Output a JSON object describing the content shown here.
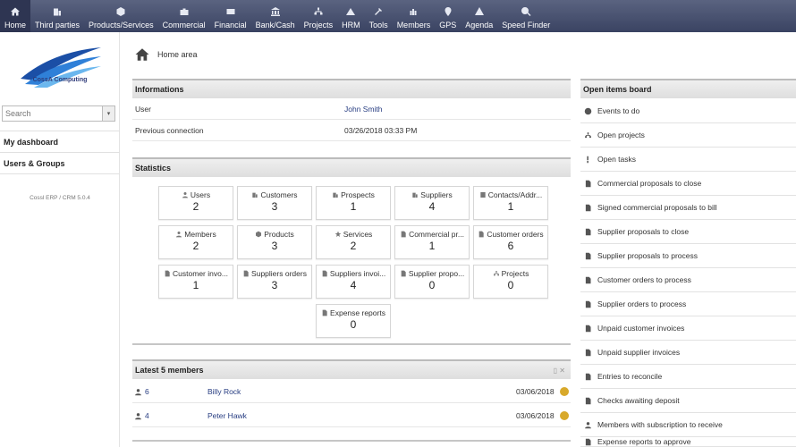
{
  "nav": [
    {
      "label": "Home",
      "icon": "home-icon",
      "active": true
    },
    {
      "label": "Third parties",
      "icon": "building-icon"
    },
    {
      "label": "Products/Services",
      "icon": "cube-icon"
    },
    {
      "label": "Commercial",
      "icon": "briefcase-icon"
    },
    {
      "label": "Financial",
      "icon": "money-icon"
    },
    {
      "label": "Bank/Cash",
      "icon": "bank-icon"
    },
    {
      "label": "Projects",
      "icon": "project-icon"
    },
    {
      "label": "HRM",
      "icon": "people-icon"
    },
    {
      "label": "Tools",
      "icon": "tools-icon"
    },
    {
      "label": "Members",
      "icon": "members-icon"
    },
    {
      "label": "GPS",
      "icon": "location-pin-icon"
    },
    {
      "label": "Agenda",
      "icon": "agenda-icon"
    },
    {
      "label": "Speed Finder",
      "icon": "search-icon"
    }
  ],
  "sidebar": {
    "logo_text": "CossA Computing",
    "search_placeholder": "Search",
    "links": [
      "My dashboard",
      "Users & Groups"
    ],
    "version": "Cossl ERP / CRM 5.0.4"
  },
  "page": {
    "title": "Home area"
  },
  "informations": {
    "title": "Informations",
    "rows": [
      {
        "label": "User",
        "value": "John Smith"
      },
      {
        "label": "Previous connection",
        "value": "03/26/2018 03:33 PM"
      }
    ]
  },
  "statistics": {
    "title": "Statistics",
    "boxes": [
      {
        "label": "Users",
        "value": "2",
        "icon": "user-icon"
      },
      {
        "label": "Customers",
        "value": "3",
        "icon": "building-icon"
      },
      {
        "label": "Prospects",
        "value": "1",
        "icon": "building-icon"
      },
      {
        "label": "Suppliers",
        "value": "4",
        "icon": "building-icon"
      },
      {
        "label": "Contacts/Addr...",
        "value": "1",
        "icon": "contact-icon"
      },
      {
        "label": "Members",
        "value": "2",
        "icon": "user-icon"
      },
      {
        "label": "Products",
        "value": "3",
        "icon": "cube-icon"
      },
      {
        "label": "Services",
        "value": "2",
        "icon": "service-icon"
      },
      {
        "label": "Commercial pr...",
        "value": "1",
        "icon": "document-icon"
      },
      {
        "label": "Customer orders",
        "value": "6",
        "icon": "document-icon"
      },
      {
        "label": "Customer invo...",
        "value": "1",
        "icon": "document-icon"
      },
      {
        "label": "Suppliers orders",
        "value": "3",
        "icon": "document-icon"
      },
      {
        "label": "Suppliers invoi...",
        "value": "4",
        "icon": "document-icon"
      },
      {
        "label": "Supplier propo...",
        "value": "0",
        "icon": "document-icon"
      },
      {
        "label": "Projects",
        "value": "0",
        "icon": "project-icon"
      },
      {
        "label": "Expense reports",
        "value": "0",
        "icon": "document-icon"
      }
    ]
  },
  "latest_members": {
    "title": "Latest 5 members",
    "rows": [
      {
        "id": "6",
        "name": "Billy Rock",
        "date": "03/06/2018"
      },
      {
        "id": "4",
        "name": "Peter Hawk",
        "date": "03/06/2018"
      }
    ]
  },
  "open_items": {
    "title": "Open items board",
    "items": [
      {
        "label": "Events to do",
        "icon": "clock-icon"
      },
      {
        "label": "Open projects",
        "icon": "project-icon"
      },
      {
        "label": "Open tasks",
        "icon": "task-icon"
      },
      {
        "label": "Commercial proposals to close",
        "icon": "document-icon"
      },
      {
        "label": "Signed commercial proposals to bill",
        "icon": "document-icon"
      },
      {
        "label": "Supplier proposals to close",
        "icon": "document-icon"
      },
      {
        "label": "Supplier proposals to process",
        "icon": "document-icon"
      },
      {
        "label": "Customer orders to process",
        "icon": "document-icon"
      },
      {
        "label": "Supplier orders to process",
        "icon": "document-icon"
      },
      {
        "label": "Unpaid customer invoices",
        "icon": "document-icon"
      },
      {
        "label": "Unpaid supplier invoices",
        "icon": "document-icon"
      },
      {
        "label": "Entries to reconcile",
        "icon": "document-icon"
      },
      {
        "label": "Checks awaiting deposit",
        "icon": "document-icon"
      },
      {
        "label": "Members with subscription to receive",
        "icon": "user-icon"
      },
      {
        "label": "Expense reports to approve",
        "icon": "document-icon"
      }
    ]
  },
  "colors": {
    "nav_bg": "#4a5270",
    "link": "#263c81",
    "status_dot": "#d8a92b"
  }
}
